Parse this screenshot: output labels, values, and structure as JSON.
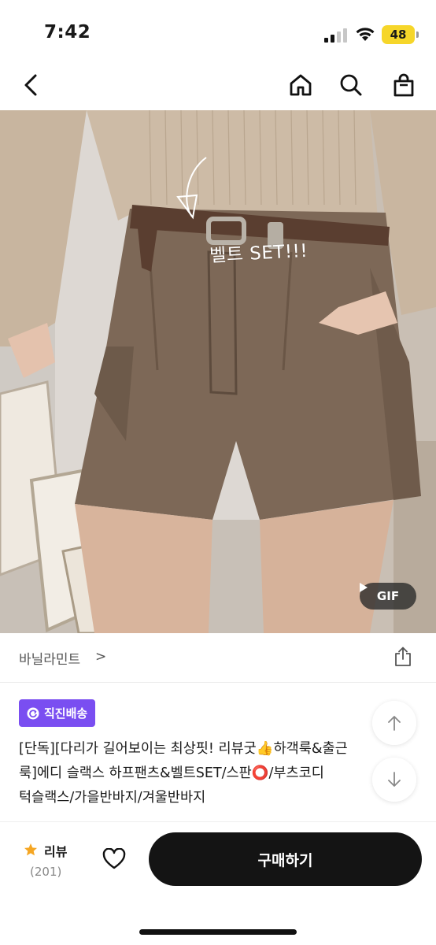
{
  "status": {
    "time": "7:42",
    "battery": "48"
  },
  "nav": {
    "icons": [
      "back-arrow-icon",
      "home-icon",
      "search-icon",
      "shopping-bag-icon"
    ]
  },
  "hero": {
    "caption": "벨트 SET!!!",
    "gif_badge": "GIF"
  },
  "store": {
    "name": "바닐라민트",
    "chevron": ">"
  },
  "badge": {
    "label": "직진배송",
    "color": "#7a4ef1"
  },
  "product": {
    "title_lines": [
      "[단독][다리가 길어보이는 최상핏! 리뷰굿👍하객룩&출근",
      "룩]에디 슬랙스 하프팬츠&벨트SET/스판⭕/부츠코디",
      "턱슬랙스/가을반바지/겨울반바지"
    ]
  },
  "bottom": {
    "review_label": "리뷰",
    "review_count": "(201)",
    "buy_label": "구매하기",
    "star_color": "#f5a623"
  }
}
